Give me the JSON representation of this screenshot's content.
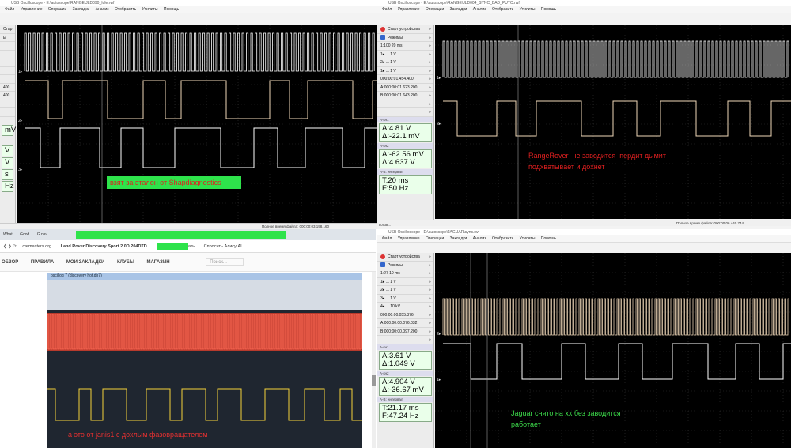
{
  "top_left": {
    "title": "USB Oscilloscope - E:\\autoscope\\RANGE\\JLD090_Idle.rwf",
    "menu": [
      "Файл",
      "Управление",
      "Операции",
      "Закладки",
      "Анализ",
      "Отобразить",
      "Утилиты",
      "Помощь"
    ],
    "panel_rows": [
      "Старт",
      "ы",
      "",
      "",
      "",
      "",
      "",
      "400",
      "400",
      "",
      "",
      "",
      "",
      "",
      ""
    ],
    "meas": [
      "mV",
      "V",
      "V",
      "s",
      "Hz"
    ],
    "channels": [
      "1▸",
      "2▸",
      "3▸"
    ],
    "note": "взят за эталон от Shapdiagnostics",
    "status": "Полное время файла: 000:00:03.198.160"
  },
  "top_right": {
    "title": "USB Oscilloscope - E:\\autoscope\\RANGE\\JLD004_SYNC_BAD_PUTO.rwf",
    "menu": [
      "Файл",
      "Управление",
      "Операции",
      "Закладки",
      "Анализ",
      "Отобразить",
      "Утилиты",
      "Помощь"
    ],
    "panel_rows": [
      "Старт устройства",
      "Режимы",
      "1:100   20 ms",
      "1▸ ... 1 V",
      "2▸ ... 1 V",
      "1▸ ... 1 V",
      "000:00:01.454.400",
      "A:000:00:01.623.200",
      "B:000:00:01.643.200",
      "",
      ""
    ],
    "meas_head1": "A-кн1",
    "meas1": [
      "A:4.81 V",
      "Δ:-22.1 mV"
    ],
    "meas_head2": "A-кн2",
    "meas2": [
      "A:-62.56 mV",
      "Δ:4.637 V"
    ],
    "meas_head3": "A-B: интервал",
    "meas3": [
      "T:20 ms",
      "F:50 Hz"
    ],
    "channels": [
      "1▸",
      "2▸"
    ],
    "note": "RangeRover  не заводится  пердит дымит\nподхватывает и дохнет",
    "status": "Полное время файла: 000:00:06.440.744",
    "ready": "Готов..."
  },
  "bottom_right": {
    "title": "USB Oscilloscope - E:\\autoscope\\JAGUAR\\sync.rwf",
    "menu": [
      "Файл",
      "Управление",
      "Операции",
      "Закладки",
      "Анализ",
      "Отобразить",
      "Утилиты",
      "Помощь"
    ],
    "panel_rows": [
      "Старт устройства",
      "Режимы",
      "1:27   10 ms",
      "1▸ ... 1 V",
      "2▸ ... 1 V",
      "3▸ ... 1 V",
      "4▸ ... 10 kV",
      "000:00:00.055.376",
      "A:000:00:00.076.032",
      "B:000:00:00.097.200",
      ""
    ],
    "meas_head1": "A-кн1",
    "meas1": [
      "A:3.61 V",
      "Δ:1.049 V"
    ],
    "meas_head2": "A-кн2",
    "meas2": [
      "A:4.904 V",
      "Δ:-36.67 mV"
    ],
    "meas_head3": "A-B: интервал",
    "meas3": [
      "T:21.17 ms",
      "F:47.24 Hz"
    ],
    "channels": [
      "2▸",
      "1▸"
    ],
    "note": "Jaguar снято на хх без заводится\nработает"
  },
  "browser": {
    "tabs": [
      "What",
      "Good",
      "G  nav"
    ],
    "address": "carmasters.org",
    "page_title": "Land Rover Discovery Sport 2.0D 204DTD...",
    "actions": [
      "Пересказать",
      "Спросить Алису AI"
    ],
    "nav": [
      "ОБЗОР",
      "ПРАВИЛА",
      "МОИ ЗАКЛАДКИ",
      "КЛУБЫ",
      "МАГАЗИН"
    ],
    "search_placeholder": "Поиск...",
    "photo_window_title": "oscillog 7 (discovery hot.dn7)",
    "photo_note": "а это от janis1 с дохлым фазовращателем"
  },
  "colors": {
    "scope_bg": "#000000",
    "trace": "#ffffff",
    "trace_warm": "#f0d8b8",
    "note_green": "#3cd84a",
    "note_red": "#e02020",
    "highlight": "#2ee34b"
  }
}
